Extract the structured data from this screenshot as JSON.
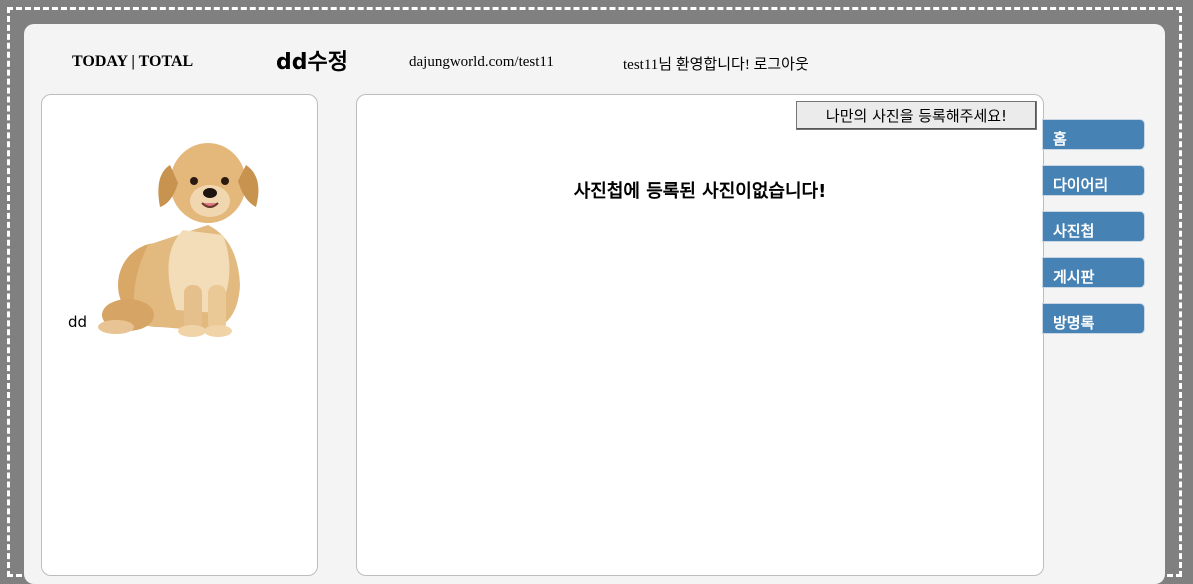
{
  "header": {
    "today_total": "TODAY | TOTAL",
    "site_title": "dd수정",
    "url": "dajungworld.com/test11",
    "welcome": "test11님 환영합니다!",
    "logout": "로그아웃"
  },
  "profile": {
    "image": "golden-retriever-puppy",
    "name": "dd"
  },
  "main": {
    "upload_button": "나만의 사진을 등록해주세요!",
    "empty_message": "사진첩에 등록된 사진이없습니다!"
  },
  "menu": [
    {
      "label": "홈"
    },
    {
      "label": "다이어리"
    },
    {
      "label": "사진첩"
    },
    {
      "label": "게시판"
    },
    {
      "label": "방명록"
    }
  ],
  "colors": {
    "background": "#808080",
    "panel": "#f4f4f4",
    "menu_tab": "#4682b4"
  }
}
